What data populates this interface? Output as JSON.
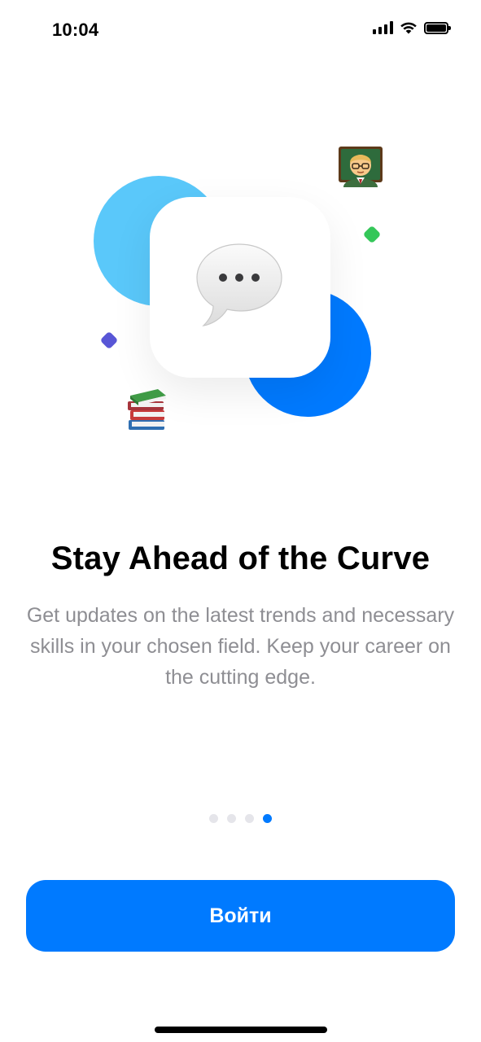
{
  "status_bar": {
    "time": "10:04",
    "icons": [
      "cellular-signal-icon",
      "wifi-icon",
      "battery-icon"
    ]
  },
  "illustration": {
    "center_icon": "speech-bubble-icon",
    "decorations": [
      "teacher-emoji-icon",
      "books-emoji-icon",
      "green-diamond",
      "purple-diamond"
    ],
    "colors": {
      "light_blue": "#5ac8fa",
      "blue": "#007aff",
      "green": "#34c759",
      "purple": "#5856d6"
    }
  },
  "onboarding": {
    "title": "Stay Ahead of the Curve",
    "description": "Get updates on the latest trends and necessary skills in your chosen field. Keep your career on the cutting edge."
  },
  "pagination": {
    "total": 4,
    "current": 4
  },
  "login_button": {
    "label": "Войти"
  },
  "accent_color": "#007aff"
}
